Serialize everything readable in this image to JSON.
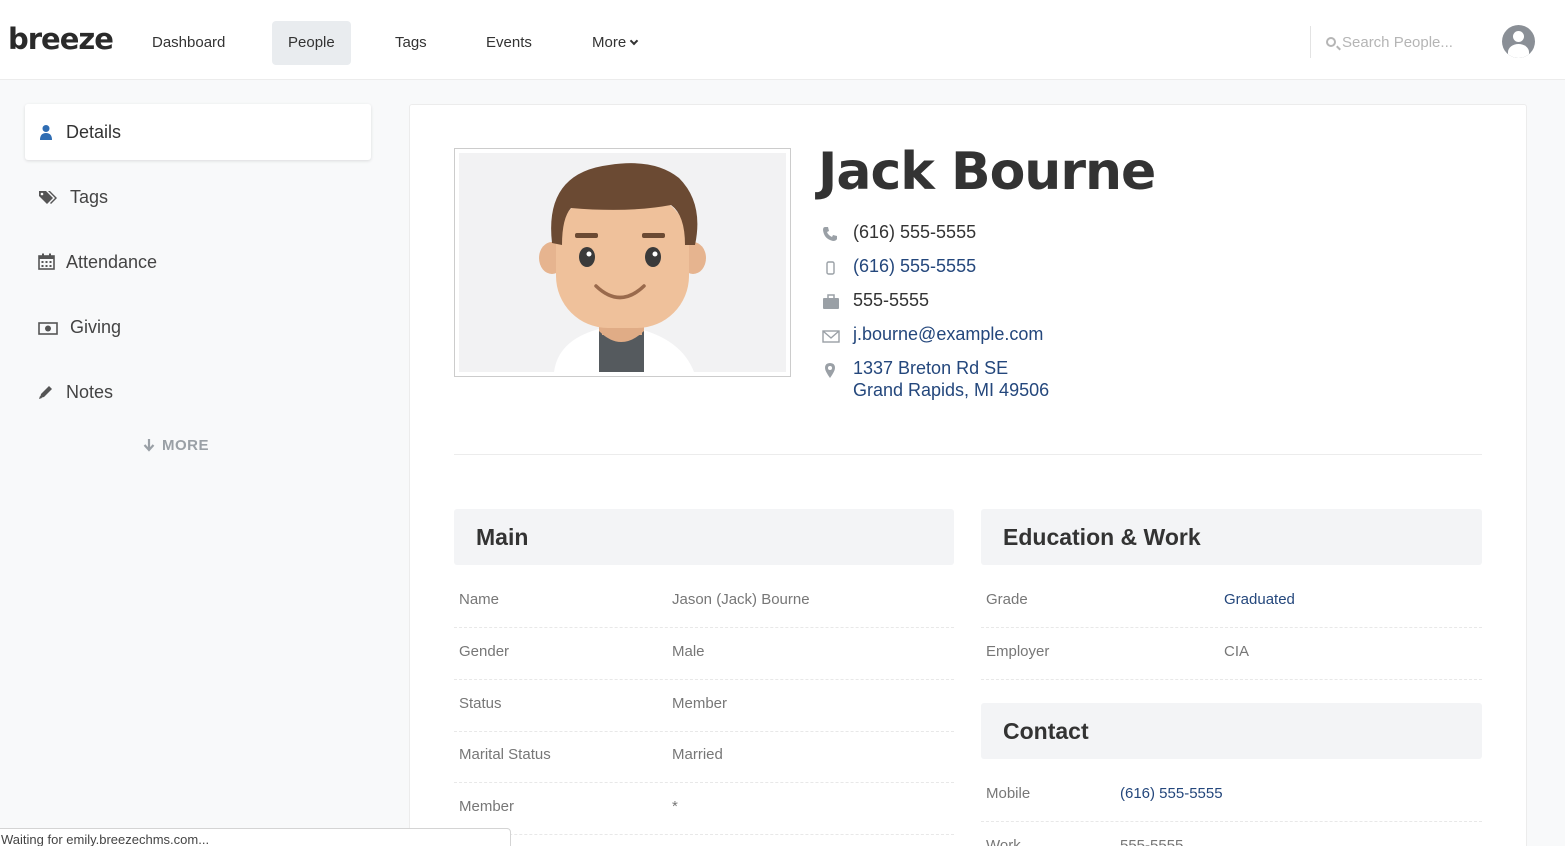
{
  "app": {
    "logo": "breeze"
  },
  "nav": {
    "items": [
      "Dashboard",
      "People",
      "Tags",
      "Events",
      "More"
    ],
    "search_placeholder": "Search People..."
  },
  "sidebar": {
    "items": [
      {
        "label": "Details",
        "icon": "user-icon"
      },
      {
        "label": "Tags",
        "icon": "tags-icon"
      },
      {
        "label": "Attendance",
        "icon": "calendar-icon"
      },
      {
        "label": "Giving",
        "icon": "money-icon"
      },
      {
        "label": "Notes",
        "icon": "pencil-icon"
      }
    ],
    "more": "MORE"
  },
  "profile": {
    "name": "Jack Bourne",
    "home_phone": "(616) 555-5555",
    "mobile_phone": "(616) 555-5555",
    "work_phone": "555-5555",
    "email": "j.bourne@example.com",
    "address_line1": "1337 Breton Rd SE",
    "address_line2": "Grand Rapids, MI 49506"
  },
  "main_section": {
    "title": "Main",
    "rows": [
      {
        "key": "Name",
        "value": "Jason (Jack) Bourne"
      },
      {
        "key": "Gender",
        "value": "Male"
      },
      {
        "key": "Status",
        "value": "Member"
      },
      {
        "key": "Marital Status",
        "value": "Married"
      },
      {
        "key": "Member",
        "value": "*"
      }
    ]
  },
  "edu_section": {
    "title": "Education & Work",
    "rows": [
      {
        "key": "Grade",
        "value": "Graduated"
      },
      {
        "key": "Employer",
        "value": "CIA"
      }
    ]
  },
  "contact_section": {
    "title": "Contact",
    "rows": [
      {
        "key": "Mobile",
        "value": "(616) 555-5555"
      },
      {
        "key": "Work",
        "value": "555-5555"
      }
    ]
  },
  "status_bar": "Waiting for emily.breezechms.com...",
  "colors": {
    "link": "#24477c",
    "active_icon": "#2f6db3"
  }
}
